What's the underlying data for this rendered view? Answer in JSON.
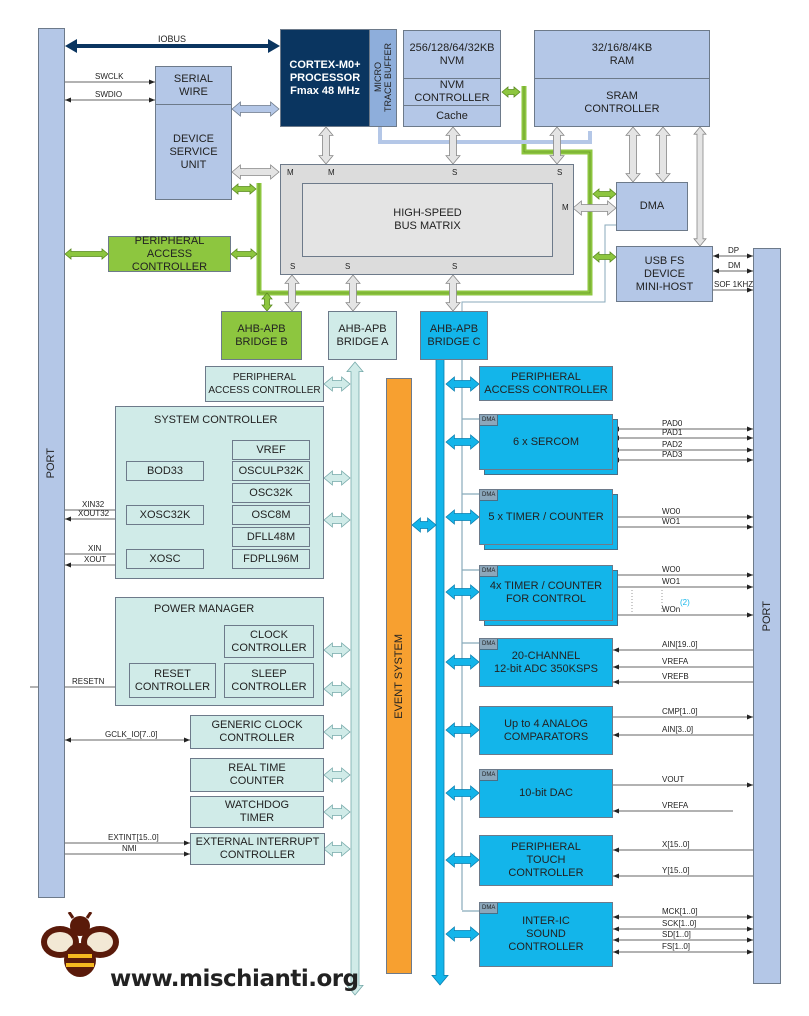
{
  "port_left": "PORT",
  "port_right": "PORT",
  "iobus": "IOBUS",
  "cpu": "CORTEX-M0+\nPROCESSOR\nFmax 48 MHz",
  "trace_buffer": "MICRO\nTRACE BUFFER",
  "serial_wire": "SERIAL\nWIRE",
  "dsu": "DEVICE\nSERVICE\nUNIT",
  "nvm": "256/128/64/32KB\nNVM",
  "nvm_ctrl": "NVM\nCONTROLLER",
  "cache": "Cache",
  "ram": "32/16/8/4KB\nRAM",
  "sram_ctrl": "SRAM\nCONTROLLER",
  "bus_matrix": "HIGH-SPEED\nBUS MATRIX",
  "master": "M",
  "slave": "S",
  "dma": "DMA",
  "usb": "USB FS\nDEVICE\nMINI-HOST",
  "pac_green": "PERIPHERAL\nACCESS CONTROLLER",
  "bridge_b": "AHB-APB\nBRIDGE B",
  "bridge_a": "AHB-APB\nBRIDGE A",
  "bridge_c": "AHB-APB\nBRIDGE C",
  "event_system": "EVENT SYSTEM",
  "pac_a": "PERIPHERAL\nACCESS CONTROLLER",
  "sysctrl": {
    "title": "SYSTEM CONTROLLER",
    "items": [
      "VREF",
      "OSCULP32K",
      "OSC32K",
      "OSC8M",
      "DFLL48M",
      "FDPLL96M",
      "BOD33",
      "XOSC32K",
      "XOSC"
    ]
  },
  "pm": {
    "title": "POWER MANAGER",
    "clock": "CLOCK\nCONTROLLER",
    "reset": "RESET\nCONTROLLER",
    "sleep": "SLEEP\nCONTROLLER"
  },
  "gclk": "GENERIC CLOCK\nCONTROLLER",
  "rtc": "REAL TIME\nCOUNTER",
  "wdt": "WATCHDOG\nTIMER",
  "eic": "EXTERNAL INTERRUPT\nCONTROLLER",
  "peripherals": {
    "pac": "PERIPHERAL\nACCESS CONTROLLER",
    "sercom": "6 x SERCOM",
    "tc": "5 x TIMER / COUNTER",
    "tcc": "4x TIMER / COUNTER\nFOR CONTROL",
    "adc": "20-CHANNEL\n12-bit ADC 350KSPS",
    "ac": "Up to 4 ANALOG\nCOMPARATORS",
    "dac": "10-bit DAC",
    "ptc": "PERIPHERAL\nTOUCH\nCONTROLLER",
    "i2s": "INTER-IC\nSOUND\nCONTROLLER",
    "dma_tag": "DMA"
  },
  "signals_left": [
    "SWCLK",
    "SWDIO",
    "XIN32",
    "XOUT32",
    "XIN",
    "XOUT",
    "RESETN",
    "GCLK_IO[7..0]",
    "EXTINT[15..0]",
    "NMI"
  ],
  "signals_right": [
    "DP",
    "DM",
    "SOF 1KHZ",
    "PAD0",
    "PAD1",
    "PAD2",
    "PAD3",
    "WO0",
    "WO1",
    "WO0",
    "WO1",
    "WOn",
    "AIN[19..0]",
    "VREFA",
    "VREFB",
    "CMP[1..0]",
    "AIN[3..0]",
    "VOUT",
    "VREFA",
    "X[15..0]",
    "Y[15..0]",
    "MCK[1..0]",
    "SCK[1..0]",
    "SD[1..0]",
    "FS[1..0]"
  ],
  "footnote": "(2)",
  "watermark": "www.mischianti.org",
  "colors": {
    "navy": "#0a3560",
    "light_blue": "#b4c7e7",
    "green": "#8dc63f",
    "teal": "#d0ebe8",
    "cyan": "#13b5ea",
    "orange": "#f7a030",
    "grey": "#dcdcdc"
  }
}
